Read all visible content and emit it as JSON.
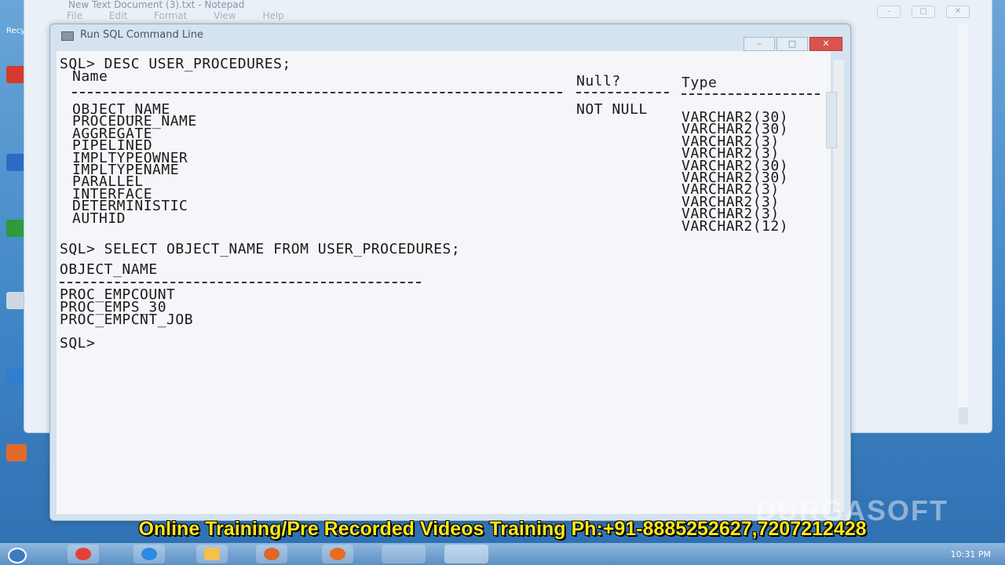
{
  "notepad": {
    "title": "New Text Document (3).txt - Notepad",
    "menu": [
      "File",
      "Edit",
      "Format",
      "View",
      "Help"
    ]
  },
  "sql_window": {
    "title": "Run SQL Command Line",
    "controls": {
      "minimize": "–",
      "maximize": "□",
      "close": "✕"
    }
  },
  "console": {
    "cmd1": "SQL> DESC USER_PROCEDURES;",
    "desc_headers": {
      "name": "Name",
      "null": "Null?",
      "type": "Type"
    },
    "desc_rows": [
      {
        "name": "OBJECT_NAME",
        "null": "NOT NULL",
        "type": "VARCHAR2(30)"
      },
      {
        "name": "PROCEDURE_NAME",
        "null": "",
        "type": "VARCHAR2(30)"
      },
      {
        "name": "AGGREGATE",
        "null": "",
        "type": "VARCHAR2(3)"
      },
      {
        "name": "PIPELINED",
        "null": "",
        "type": "VARCHAR2(3)"
      },
      {
        "name": "IMPLTYPEOWNER",
        "null": "",
        "type": "VARCHAR2(30)"
      },
      {
        "name": "IMPLTYPENAME",
        "null": "",
        "type": "VARCHAR2(30)"
      },
      {
        "name": "PARALLEL",
        "null": "",
        "type": "VARCHAR2(3)"
      },
      {
        "name": "INTERFACE",
        "null": "",
        "type": "VARCHAR2(3)"
      },
      {
        "name": "DETERMINISTIC",
        "null": "",
        "type": "VARCHAR2(3)"
      },
      {
        "name": "AUTHID",
        "null": "",
        "type": "VARCHAR2(12)"
      }
    ],
    "cmd2": "SQL> SELECT OBJECT_NAME FROM USER_PROCEDURES;",
    "result_header": "OBJECT_NAME",
    "result_rows": [
      "PROC_EMPCOUNT",
      "PROC_EMPS_30",
      "PROC_EMPCNT_JOB"
    ],
    "prompt": "SQL>"
  },
  "watermark": "DURGASOFT",
  "banner": "Online Training/Pre Recorded Videos Training Ph:+91-8885252627,7207212428",
  "taskbar": {
    "items": [
      "start-orb",
      "chrome",
      "internet-explorer",
      "file-explorer",
      "media-player",
      "firefox",
      "notepad",
      "sql-command-line"
    ],
    "clock": "10:31 PM"
  }
}
